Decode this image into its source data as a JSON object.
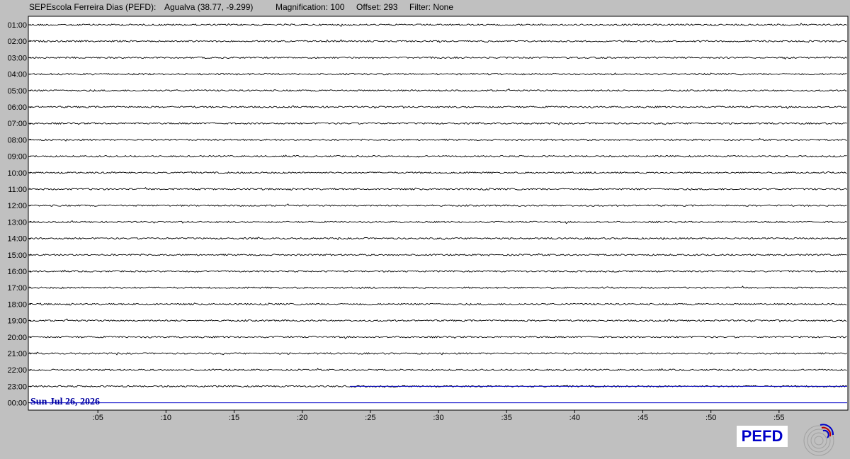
{
  "header": {
    "station": "SEPEscola Ferreira Dias (PEFD):",
    "location": "Agualva (38.77, -9.299)",
    "magnification": "Magnification: 100",
    "offset": "Offset: 293",
    "filter": "Filter: None"
  },
  "chart_data": {
    "type": "line",
    "title": "",
    "date_label": "Sun Jul 26, 2026",
    "hour_labels": [
      "01:00",
      "02:00",
      "03:00",
      "04:00",
      "05:00",
      "06:00",
      "07:00",
      "08:00",
      "09:00",
      "10:00",
      "11:00",
      "12:00",
      "13:00",
      "14:00",
      "15:00",
      "16:00",
      "17:00",
      "18:00",
      "19:00",
      "20:00",
      "21:00",
      "22:00",
      "23:00",
      "00:00"
    ],
    "minute_ticks": [
      ":05",
      ":10",
      ":15",
      ":20",
      ":25",
      ":30",
      ":35",
      ":40",
      ":45",
      ":50",
      ":55"
    ],
    "minute_tick_values": [
      5,
      10,
      15,
      20,
      25,
      30,
      35,
      40,
      45,
      50,
      55
    ],
    "xlim": [
      0,
      60
    ],
    "traces_recorded": 23,
    "trace_color": "#000000",
    "current_trace_color": "#0000c8",
    "grid": false
  },
  "logo": {
    "text": "PEFD",
    "seal_name": "seismograph-seal"
  }
}
